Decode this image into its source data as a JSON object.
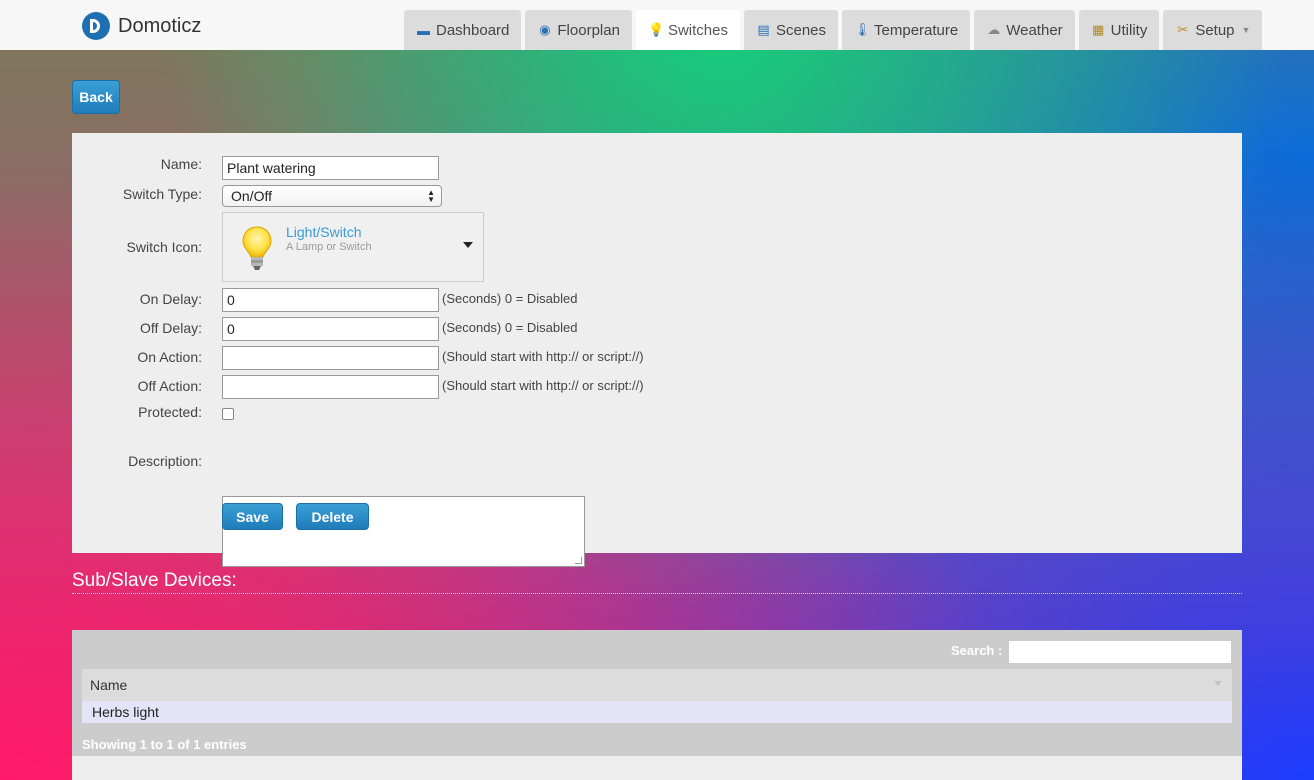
{
  "app": {
    "name": "Domoticz"
  },
  "nav": {
    "tabs": [
      {
        "label": "Dashboard",
        "icon": "dashboard-icon"
      },
      {
        "label": "Floorplan",
        "icon": "floorplan-icon"
      },
      {
        "label": "Switches",
        "icon": "lightbulb-icon",
        "active": true
      },
      {
        "label": "Scenes",
        "icon": "clapperboard-icon"
      },
      {
        "label": "Temperature",
        "icon": "thermometer-icon"
      },
      {
        "label": "Weather",
        "icon": "cloud-rain-icon"
      },
      {
        "label": "Utility",
        "icon": "utility-icon"
      },
      {
        "label": "Setup",
        "icon": "tools-icon",
        "dropdown": true
      }
    ]
  },
  "back_label": "Back",
  "form": {
    "name_label": "Name:",
    "name_value": "Plant watering",
    "switch_type_label": "Switch Type:",
    "switch_type_value": "On/Off",
    "switch_icon_label": "Switch Icon:",
    "switch_icon_title": "Light/Switch",
    "switch_icon_desc": "A Lamp or Switch",
    "on_delay_label": "On Delay:",
    "on_delay_value": "0",
    "on_delay_hint": "(Seconds) 0 = Disabled",
    "off_delay_label": "Off Delay:",
    "off_delay_value": "0",
    "off_delay_hint": "(Seconds) 0 = Disabled",
    "on_action_label": "On Action:",
    "on_action_value": "",
    "on_action_hint": "(Should start with http:// or script://)",
    "off_action_label": "Off Action:",
    "off_action_value": "",
    "off_action_hint": "(Should start with http:// or script://)",
    "protected_label": "Protected:",
    "protected_checked": false,
    "description_label": "Description:",
    "description_value": "",
    "save_label": "Save",
    "delete_label": "Delete"
  },
  "sub_devices": {
    "title": "Sub/Slave Devices:",
    "search_label": "Search :",
    "search_value": "",
    "columns": [
      "Name"
    ],
    "rows": [
      [
        "Herbs light"
      ]
    ],
    "info": "Showing 1 to 1 of 1 entries"
  },
  "colors": {
    "accent": "#2b88c8",
    "link": "#3b9ad9"
  }
}
